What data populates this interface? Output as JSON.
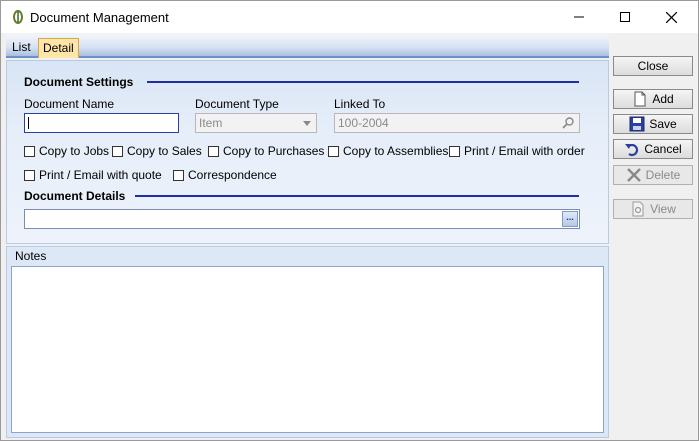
{
  "window": {
    "title": "Document Management"
  },
  "tabs": [
    {
      "label": "List"
    },
    {
      "label": "Detail"
    }
  ],
  "settings": {
    "heading": "Document Settings",
    "document_name_label": "Document Name",
    "document_name_value": "",
    "document_type_label": "Document Type",
    "document_type_value": "Item",
    "linked_to_label": "Linked To",
    "linked_to_value": "100-2004",
    "checkboxes": [
      {
        "label": "Copy to Jobs",
        "checked": false
      },
      {
        "label": "Copy to Sales",
        "checked": false
      },
      {
        "label": "Copy to Purchases",
        "checked": false
      },
      {
        "label": "Copy to Assemblies",
        "checked": false
      },
      {
        "label": "Print / Email with order",
        "checked": false
      },
      {
        "label": "Print / Email with quote",
        "checked": false
      },
      {
        "label": "Correspondence",
        "checked": false
      }
    ]
  },
  "details": {
    "heading": "Document Details",
    "path_value": "",
    "browse_label": "..."
  },
  "notes": {
    "label": "Notes",
    "value": ""
  },
  "buttons": {
    "close": "Close",
    "add": "Add",
    "save": "Save",
    "cancel": "Cancel",
    "delete": "Delete",
    "view": "View"
  },
  "colors": {
    "accent_line": "#1f2fa0",
    "tab_active": "#ffe6a8",
    "panel_bg": "#dde8f6"
  }
}
